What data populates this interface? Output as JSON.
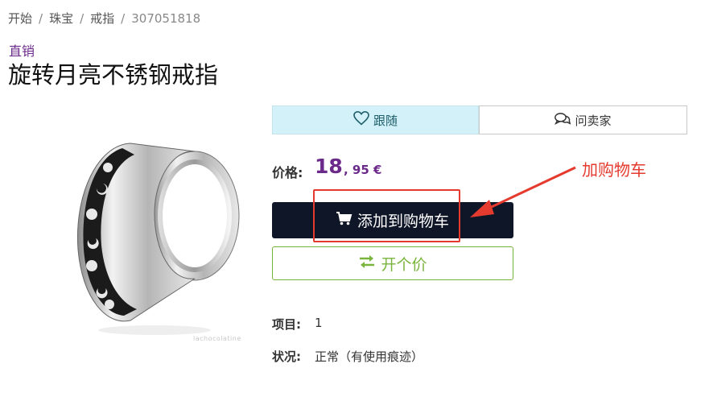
{
  "breadcrumb": {
    "items": [
      "开始",
      "珠宝",
      "戒指"
    ],
    "current": "307051818",
    "separator": "/"
  },
  "product": {
    "category": "直销",
    "title": "旋转月亮不锈钢戒指",
    "image_watermark": "lachocolatine",
    "image_icon": "ring-image"
  },
  "actions": {
    "follow_label": "跟随",
    "ask_seller_label": "问卖家",
    "add_to_cart_label": "添加到购物车",
    "make_offer_label": "开个价"
  },
  "price": {
    "label": "价格:",
    "integer": "18",
    "decimal": ", 95 €"
  },
  "annotation": {
    "label": "加购物车",
    "color": "#e53a2e"
  },
  "details": {
    "quantity_label": "项目:",
    "quantity_value": "1",
    "condition_label": "状况:",
    "condition_value": "正常（有使用痕迹）"
  },
  "colors": {
    "accent": "#6b2a8a",
    "cart_bg": "#0f1628",
    "offer": "#79b43c",
    "follow_bg": "#d3f1f8"
  }
}
